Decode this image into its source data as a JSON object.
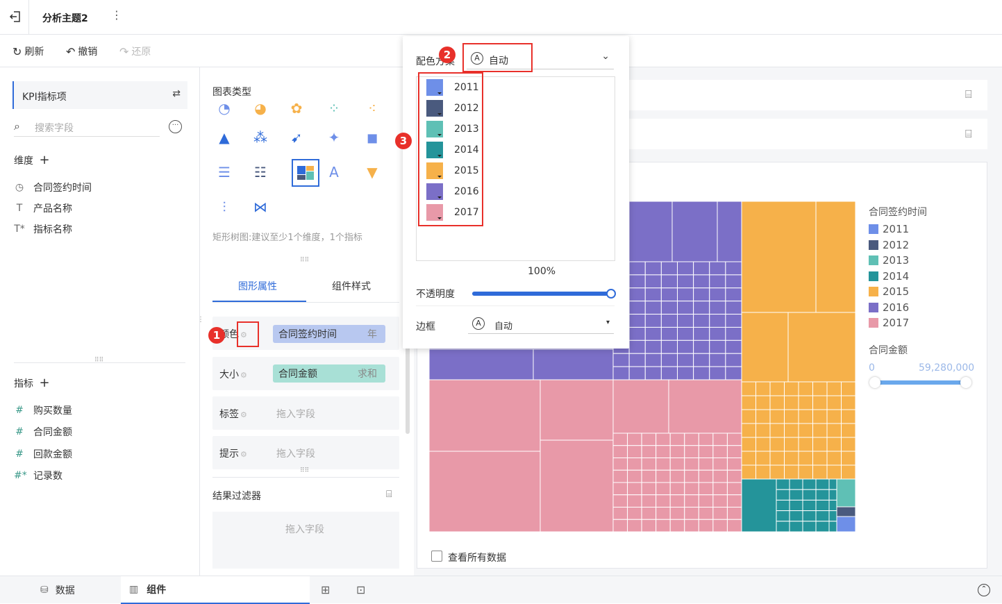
{
  "header": {
    "back_icon": "exit-icon",
    "title": "分析主题2",
    "more_icon": "more-vertical-icon"
  },
  "toolbar": {
    "refresh": "刷新",
    "undo": "撤销",
    "redo": "还原"
  },
  "left": {
    "kpi_title": "KPI指标项",
    "search_placeholder": "搜索字段",
    "dimensions_title": "维度",
    "dimensions": [
      {
        "icon": "clock-icon",
        "label": "合同签约时间"
      },
      {
        "icon": "text-icon",
        "label": "产品名称"
      },
      {
        "icon": "text-star-icon",
        "label": "指标名称"
      }
    ],
    "measures_title": "指标",
    "measures": [
      {
        "label": "购买数量"
      },
      {
        "label": "合同金额"
      },
      {
        "label": "回款金额"
      },
      {
        "label": "记录数"
      }
    ]
  },
  "middle": {
    "chart_type_title": "图表类型",
    "chart_hint": "矩形树图:建议至少1个维度，1个指标",
    "tabs": [
      "图形属性",
      "组件样式"
    ],
    "color_label": "颜色",
    "color_chip": {
      "label": "合同签约时间",
      "suffix": "年"
    },
    "size_label": "大小",
    "size_chip": {
      "label": "合同金额",
      "suffix": "求和"
    },
    "tag_label": "标签",
    "tip_label": "提示",
    "drop_placeholder": "拖入字段",
    "filter_title": "结果过滤器",
    "filter_placeholder": "拖入字段"
  },
  "popup": {
    "scheme_label": "配色方案",
    "scheme_value": "自动",
    "items": [
      {
        "year": "2011",
        "color": "#6e8fe8"
      },
      {
        "year": "2012",
        "color": "#4a5a7e"
      },
      {
        "year": "2013",
        "color": "#5fc0b5"
      },
      {
        "year": "2014",
        "color": "#24949a"
      },
      {
        "year": "2015",
        "color": "#f6b14a"
      },
      {
        "year": "2016",
        "color": "#7b6fc7"
      },
      {
        "year": "2017",
        "color": "#e899a8"
      }
    ],
    "opacity_value": "100%",
    "opacity_label": "不透明度",
    "border_label": "边框",
    "border_value": "自动",
    "opacity_level": 1.0
  },
  "legend": {
    "title": "合同签约时间",
    "items": [
      {
        "label": "2011",
        "color": "#6e8fe8"
      },
      {
        "label": "2012",
        "color": "#4a5a7e"
      },
      {
        "label": "2013",
        "color": "#5fc0b5"
      },
      {
        "label": "2014",
        "color": "#24949a"
      },
      {
        "label": "2015",
        "color": "#f6b14a"
      },
      {
        "label": "2016",
        "color": "#7b6fc7"
      },
      {
        "label": "2017",
        "color": "#e899a8"
      }
    ],
    "size_title": "合同金额",
    "size_min": "0",
    "size_max": "59,280,000"
  },
  "canvas": {
    "view_all": "查看所有数据"
  },
  "bottom": {
    "data_tab": "数据",
    "component_tab": "组件"
  },
  "annotations": [
    "1",
    "2",
    "3"
  ]
}
